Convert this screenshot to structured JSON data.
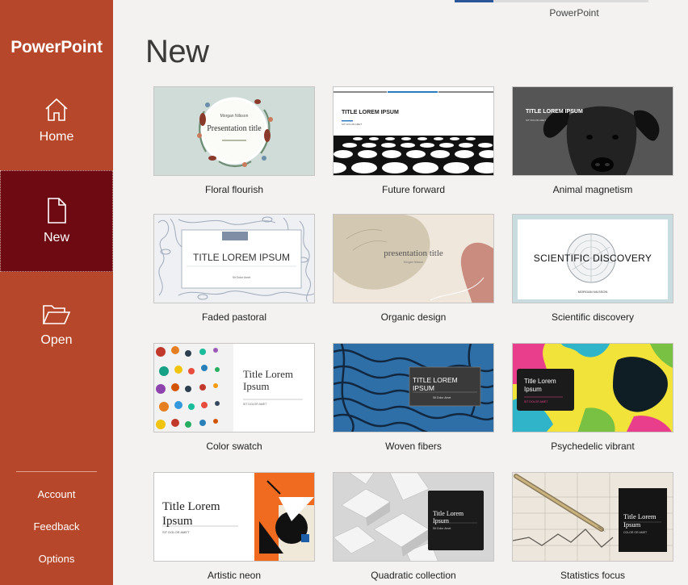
{
  "sidebar": {
    "brand": "PowerPoint",
    "nav": [
      {
        "label": "Home",
        "icon": "home-icon"
      },
      {
        "label": "New",
        "icon": "new-document-icon"
      },
      {
        "label": "Open",
        "icon": "folder-open-icon"
      }
    ],
    "links": [
      "Account",
      "Feedback",
      "Options"
    ]
  },
  "top": {
    "label": "PowerPoint"
  },
  "page_title": "New",
  "templates": [
    {
      "name": "Floral flourish",
      "thumb": {
        "author": "Morgan Nilsson",
        "title": "Presentation title"
      }
    },
    {
      "name": "Future forward",
      "thumb": {
        "title": "TITLE LOREM IPSUM",
        "subtitle": "SIT DOLOR AMET"
      }
    },
    {
      "name": "Animal magnetism",
      "thumb": {
        "title": "TITLE LOREM IPSUM",
        "subtitle": "SIT DOLOR AMET"
      }
    },
    {
      "name": "Faded pastoral",
      "thumb": {
        "title": "TITLE LOREM IPSUM",
        "subtitle": "Sit Dolor Amet"
      }
    },
    {
      "name": "Organic design",
      "thumb": {
        "title": "presentation title",
        "subtitle": "Morgan Nilsson"
      }
    },
    {
      "name": "Scientific discovery",
      "thumb": {
        "title": "SCIENTIFIC DISCOVERY",
        "subtitle": "MORGAN NILSSON"
      }
    },
    {
      "name": "Color swatch",
      "thumb": {
        "title": "Title Lorem Ipsum",
        "subtitle": "SIT DOLOR AMET"
      }
    },
    {
      "name": "Woven fibers",
      "thumb": {
        "title": "TITLE LOREM IPSUM",
        "subtitle": "Sit Dolor Amet"
      }
    },
    {
      "name": "Psychedelic vibrant",
      "thumb": {
        "title": "Title Lorem Ipsum",
        "subtitle": "SIT DOLOR AMET"
      }
    },
    {
      "name": "Artistic neon",
      "thumb": {
        "title": "Title Lorem Ipsum",
        "subtitle": "SIT DOLOR AMET"
      }
    },
    {
      "name": "Quadratic collection",
      "thumb": {
        "title": "Title Lorem Ipsum",
        "subtitle": "Sit Dolor Amet"
      }
    },
    {
      "name": "Statistics focus",
      "thumb": {
        "title": "Title Lorem Ipsum",
        "subtitle": "COLOR OR AMET"
      }
    }
  ],
  "colors": {
    "sidebar": "#b7472a",
    "sidebar_active": "#6e0b12",
    "accent": "#2b579a",
    "background": "#f3f2f1"
  }
}
